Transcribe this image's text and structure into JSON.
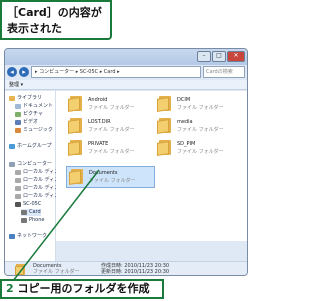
{
  "callout_top": {
    "line1": "［Card］の内容が",
    "line2": "表示された"
  },
  "window": {
    "address": "▸ コンピューター ▸ SC-05C ▸ Card ▸",
    "search_placeholder": "Cardの検索",
    "toolbar": "整理 ▾",
    "buttons": {
      "minimize": "–",
      "maximize": "□",
      "close": "✕"
    }
  },
  "sidebar": {
    "items": [
      {
        "label": "ライブラリ",
        "icon": "library-icon"
      },
      {
        "label": "ドキュメント",
        "icon": "document-icon"
      },
      {
        "label": "ピクチャ",
        "icon": "picture-icon"
      },
      {
        "label": "ビデオ",
        "icon": "video-icon"
      },
      {
        "label": "ミュージック",
        "icon": "music-icon"
      },
      {
        "label": "ホームグループ",
        "icon": "homegroup-icon"
      },
      {
        "label": "コンピューター",
        "icon": "computer-icon"
      },
      {
        "label": "ローカル ディス",
        "icon": "disk-icon"
      },
      {
        "label": "ローカル ディス",
        "icon": "disk-icon"
      },
      {
        "label": "ローカル ディス",
        "icon": "disk-icon"
      },
      {
        "label": "ローカル ディス",
        "icon": "disk-icon"
      },
      {
        "label": "SC-05C",
        "icon": "device-icon"
      },
      {
        "label": "Card",
        "icon": "card-icon"
      },
      {
        "label": "Phone",
        "icon": "phone-icon"
      },
      {
        "label": "ネットワーク",
        "icon": "network-icon"
      }
    ]
  },
  "files": [
    {
      "name": "Android",
      "type": "ファイル フォルダー"
    },
    {
      "name": "DCIM",
      "type": "ファイル フォルダー"
    },
    {
      "name": "LOST.DIR",
      "type": "ファイル フォルダー"
    },
    {
      "name": "media",
      "type": "ファイル フォルダー"
    },
    {
      "name": "PRIVATE",
      "type": "ファイル フォルダー"
    },
    {
      "name": "SD_PIM",
      "type": "ファイル フォルダー"
    },
    {
      "name": "Documents",
      "type": "ファイル フォルダー"
    }
  ],
  "status": {
    "name": "Documents",
    "type": "ファイル フォルダー",
    "created": "作成日時: 2010/11/23 20:30",
    "modified": "更新日時: 2010/11/23 20:30"
  },
  "callout_bottom": {
    "number": "2",
    "text": "コピー用のフォルダを作成"
  },
  "colors": {
    "callout_border": "#1a7a3c",
    "selection": "#cde4fb",
    "folder": "#f3cf6f"
  }
}
